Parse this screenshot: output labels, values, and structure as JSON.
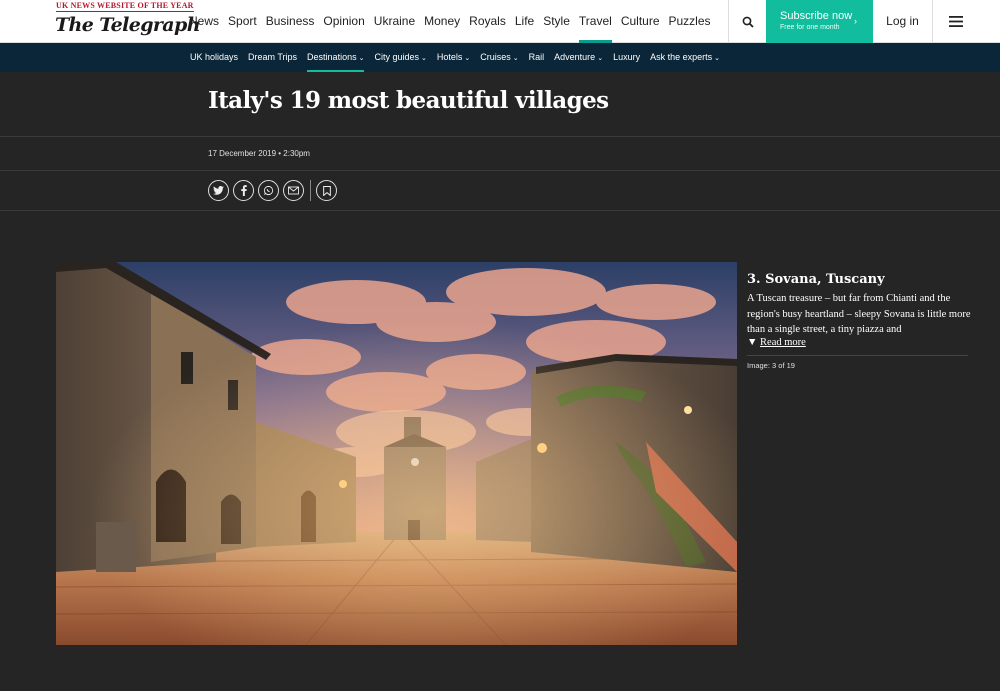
{
  "header": {
    "award": "UK NEWS WEBSITE OF THE YEAR",
    "logo": "The Telegraph",
    "nav": [
      "News",
      "Sport",
      "Business",
      "Opinion",
      "Ukraine",
      "Money",
      "Royals",
      "Life",
      "Style",
      "Travel",
      "Culture",
      "Puzzles"
    ],
    "active_nav": "Travel",
    "search_icon": "search-icon",
    "subscribe_label": "Subscribe now",
    "subscribe_sub": "Free for one month",
    "subscribe_arrow": "›",
    "login_label": "Log in",
    "menu_icon": "hamburger-menu-icon"
  },
  "subnav": {
    "items": [
      {
        "label": "UK holidays",
        "chevron": ""
      },
      {
        "label": "Dream Trips",
        "chevron": ""
      },
      {
        "label": "Destinations",
        "chevron": "⌄"
      },
      {
        "label": "City guides",
        "chevron": "⌄"
      },
      {
        "label": "Hotels",
        "chevron": "⌄"
      },
      {
        "label": "Cruises",
        "chevron": "⌄"
      },
      {
        "label": "Rail",
        "chevron": ""
      },
      {
        "label": "Adventure",
        "chevron": "⌄"
      },
      {
        "label": "Luxury",
        "chevron": ""
      },
      {
        "label": "Ask the experts",
        "chevron": "⌄"
      }
    ],
    "active": "Destinations"
  },
  "article": {
    "headline": "Italy's 19 most beautiful villages",
    "date": "17 December 2019 • 2:30pm",
    "share_icons": [
      "twitter-icon",
      "facebook-icon",
      "whatsapp-icon",
      "email-icon",
      "bookmark-icon"
    ]
  },
  "gallery": {
    "caption_title": "3. Sovana, Tuscany",
    "caption_body": "A Tuscan treasure – but far from Chianti and the region's busy heartland – sleepy Sovana is little more than a single street, a tiny piazza and",
    "read_more_arrow": "▼",
    "read_more": "Read more",
    "image_count": "Image: 3 of 19"
  },
  "colors": {
    "accent": "#12bd9d",
    "subnav_bg": "#0a2638",
    "page_bg": "#252525"
  }
}
